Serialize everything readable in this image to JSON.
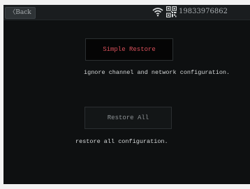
{
  "header": {
    "back_label": "〈Back",
    "phone_number": "19833976862"
  },
  "main": {
    "simple_restore_label": "Simple Restore",
    "simple_restore_desc": "ignore channel and network configuration.",
    "restore_all_label": "Restore All",
    "restore_all_desc": "restore all configuration."
  },
  "colors": {
    "background": "#0e1011",
    "simple_restore_text": "#d9505a",
    "restore_all_text": "#8d9295"
  },
  "icons": [
    "wifi-icon",
    "qr-code-icon"
  ]
}
